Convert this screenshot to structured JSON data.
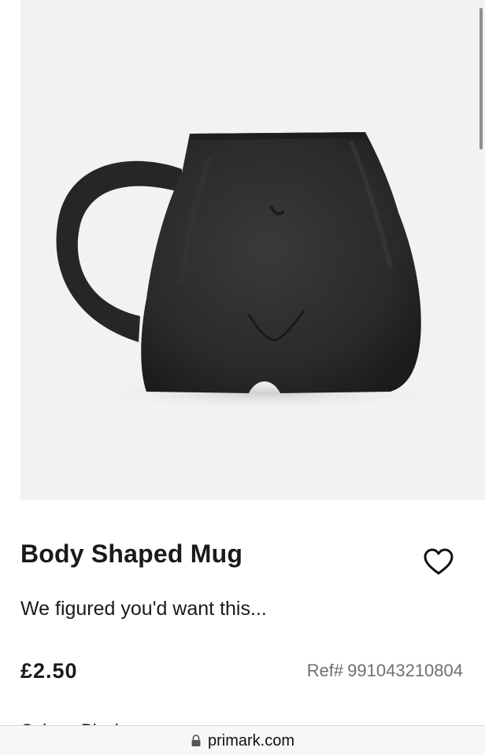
{
  "product": {
    "title": "Body Shaped Mug",
    "description": "We figured you'd want this...",
    "price": "£2.50",
    "ref_label": "Ref#",
    "ref_number": "991043210804",
    "colour_label": "Colour:",
    "colour_value": "Black"
  },
  "browser": {
    "url": "primark.com"
  },
  "icons": {
    "favourite": "heart-outline-icon",
    "lock": "lock-icon"
  },
  "colors": {
    "image_background": "#f2f2f2",
    "mug": "#2b2b2b",
    "text": "#1a1a1a",
    "ref_text": "#6f6f6f"
  }
}
